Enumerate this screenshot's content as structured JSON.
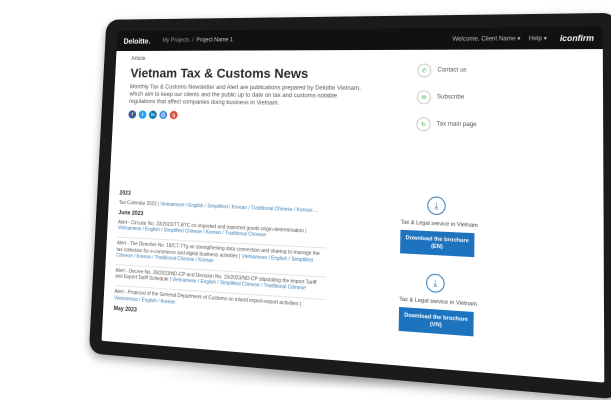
{
  "topbar": {
    "brand": "Deloitte.",
    "breadcrumb": [
      "My Projects",
      "Project Name 1"
    ],
    "nav": [
      "Welcome, Client Name ▾",
      "Help ▾"
    ],
    "right_brand": "iconfirm"
  },
  "article": {
    "kicker": "Article",
    "title": "Vietnam Tax & Customs News",
    "intro": "Monthly Tax & Customs Newsletter and Alert are publications prepared by Deloitte Vietnam, which aim to keep our clients and the public up to date on tax and customs notable regulations that affect companies doing business in Vietnam.",
    "share": [
      {
        "name": "facebook",
        "letter": "f",
        "color": "#3b5998"
      },
      {
        "name": "twitter",
        "letter": "t",
        "color": "#1da1f2"
      },
      {
        "name": "linkedin",
        "letter": "in",
        "color": "#0077b5"
      },
      {
        "name": "email",
        "letter": "@",
        "color": "#4a90d9"
      },
      {
        "name": "google-plus",
        "letter": "g",
        "color": "#dd4b39"
      }
    ]
  },
  "right_links": [
    {
      "label": "Contact us",
      "icon": "phone-icon",
      "glyph": "✆"
    },
    {
      "label": "Subscribe",
      "icon": "subscribe-icon",
      "glyph": "✉"
    },
    {
      "label": "Tax main page",
      "icon": "link-icon",
      "glyph": "↻"
    }
  ],
  "publications": {
    "year_heading": "2023",
    "calendar_prefix": "Tax Calendar 2023 | ",
    "calendar_links": "Vietnamese / English / Simplified / Korean / Traditional Chinese / Korean ...",
    "month1": "June 2023",
    "items_june": [
      {
        "text": "Alert - Circular No. 33/2023/TT-BTC on imported and exported goods origin determination | ",
        "links": "Vietnamese / English / Simplified Chinese / Korean / Traditional Chinese"
      },
      {
        "text": "Alert - The Directive No. 18/CT-TTg on strengthening data connection and sharing to manage the tax collection for e-commerce and digital business activities | ",
        "links": "Vietnamese / English / Simplified Chinese / Korean / Traditional Chinese / Korean"
      },
      {
        "text": "Alert - Decree No. 26/2023/ND-CP and Decision No. 15/2023/ND-CP stipulating the import Tariff and Export Tariff Schedule | ",
        "links": "Vietnamese / English / Simplified Chinese / Traditional Chinese"
      },
      {
        "text": "Alert - Proposal of the General Department of Customs on inland import-export activities | ",
        "links": "Vietnamese / English / Korean"
      }
    ],
    "month2": "May 2023"
  },
  "downloads": [
    {
      "title": "Tax & Legal service in Vietnam",
      "button": "Download the brochure (EN)"
    },
    {
      "title": "Tax & Legal service in Vietnam",
      "button": "Download the brochure (VN)"
    }
  ]
}
